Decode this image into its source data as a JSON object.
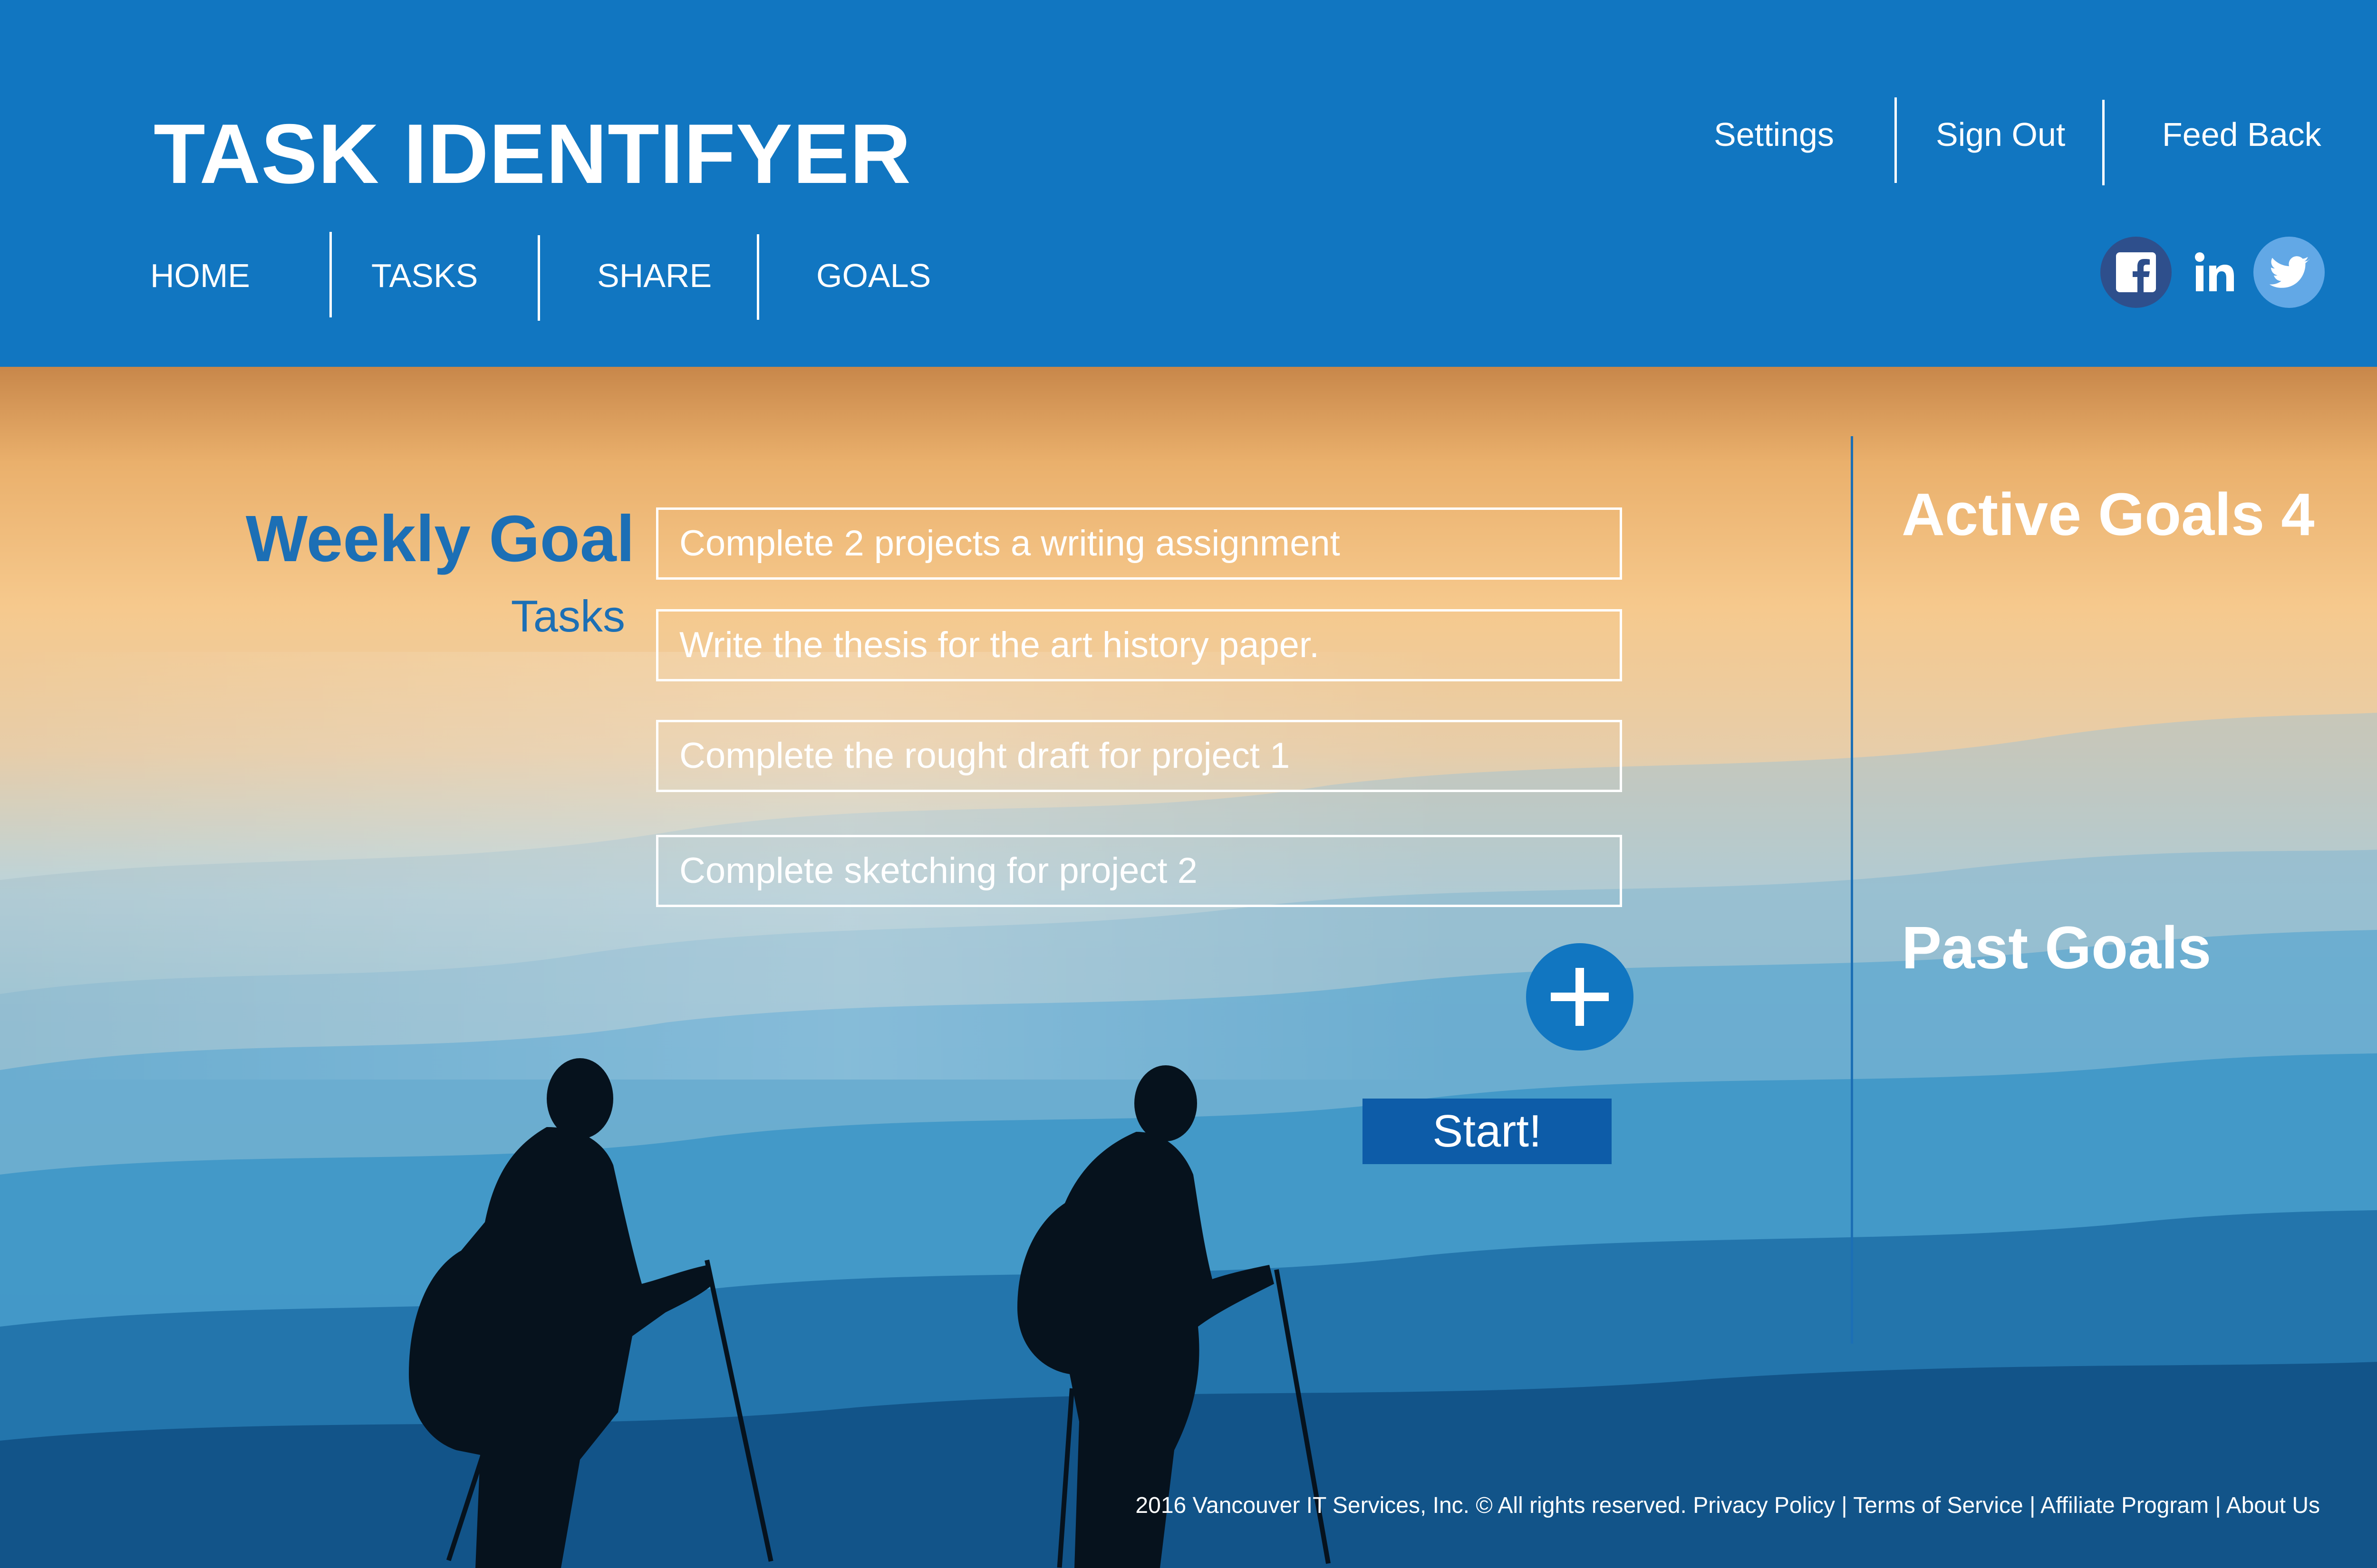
{
  "header": {
    "brand": "TASK IDENTIFYER",
    "top_links": [
      "Settings",
      "Sign Out",
      "Feed Back"
    ],
    "nav": [
      "HOME",
      "TASKS",
      "SHARE",
      "GOALS"
    ],
    "social": [
      "facebook-icon",
      "linkedin-icon",
      "twitter-icon"
    ]
  },
  "form": {
    "title": "Weekly Goal",
    "tasks_label": "Tasks",
    "goal_value": "Complete 2 projects a writing assignment",
    "tasks": [
      "Write the thesis for the art history paper.",
      "Complete the rought draft for project 1",
      "Complete sketching for project 2"
    ],
    "add_icon": "plus-icon",
    "start_label": "Start!"
  },
  "panel": {
    "active_goals": "Active Goals 4",
    "past_goals": "Past Goals"
  },
  "footer": {
    "text": "2016 Vancouver IT Services, Inc. © All rights reserved. Privacy Policy | Terms of Service | Affiliate Program | About Us"
  },
  "colors": {
    "brand_blue": "#1176c1",
    "title_blue": "#1c6fb5",
    "button_blue": "#0d5ca8"
  }
}
